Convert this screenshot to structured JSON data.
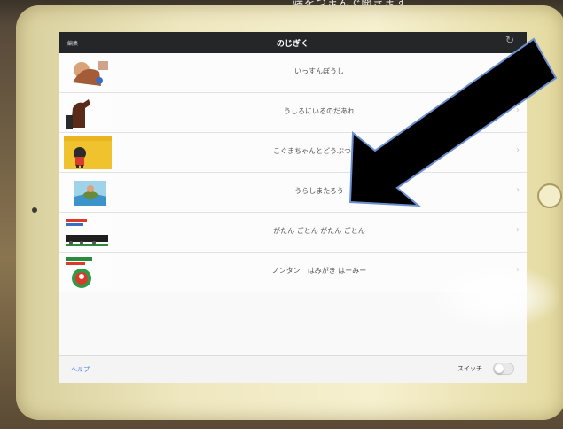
{
  "page": {
    "top_caption": "端をつまんで開きます"
  },
  "nav": {
    "left_label": "編集",
    "title": "のじぎく",
    "refresh_icon": "refresh-icon"
  },
  "books": [
    {
      "title": "いっすんぼうし",
      "thumb": "book-cover-issunboushi"
    },
    {
      "title": "うしろにいるのだあれ",
      "thumb": "book-cover-ushiro"
    },
    {
      "title": "こぐまちゃんとどうぶつえん",
      "thumb": "book-cover-koguma"
    },
    {
      "title": "うらしまたろう",
      "thumb": "book-cover-urashima"
    },
    {
      "title": "がたん ごとん がたん ごとん",
      "thumb": "book-cover-gatan"
    },
    {
      "title": "ノンタン　はみがき はーみー",
      "thumb": "book-cover-nontan"
    }
  ],
  "footer": {
    "help_label": "ヘルプ",
    "switch_label": "スイッチ"
  },
  "colors": {
    "nav_bg": "#252628",
    "accent": "#4a79d8",
    "arrow_fill": "#000000",
    "arrow_outline": "#6c8fd1"
  }
}
